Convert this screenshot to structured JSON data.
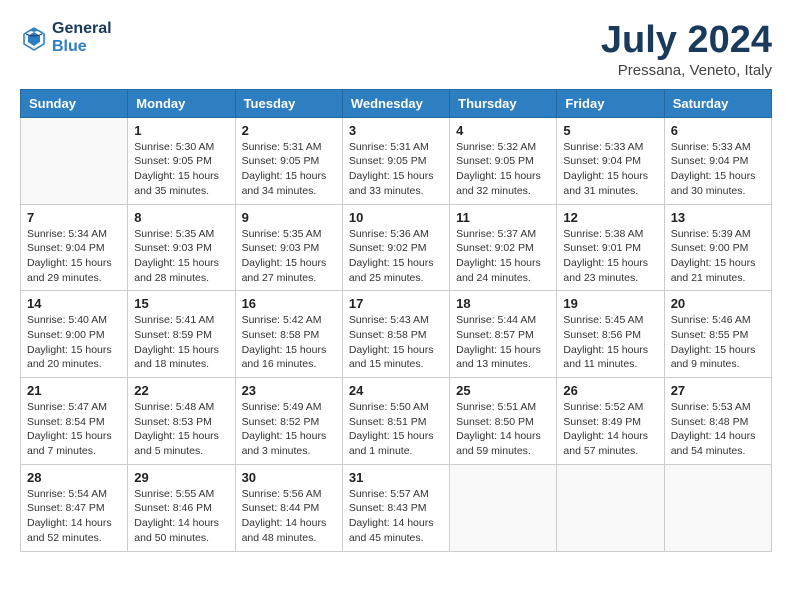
{
  "logo": {
    "line1": "General",
    "line2": "Blue"
  },
  "title": "July 2024",
  "subtitle": "Pressana, Veneto, Italy",
  "weekdays": [
    "Sunday",
    "Monday",
    "Tuesday",
    "Wednesday",
    "Thursday",
    "Friday",
    "Saturday"
  ],
  "weeks": [
    [
      {
        "day": null
      },
      {
        "day": 1,
        "sunrise": "5:30 AM",
        "sunset": "9:05 PM",
        "daylight": "15 hours and 35 minutes."
      },
      {
        "day": 2,
        "sunrise": "5:31 AM",
        "sunset": "9:05 PM",
        "daylight": "15 hours and 34 minutes."
      },
      {
        "day": 3,
        "sunrise": "5:31 AM",
        "sunset": "9:05 PM",
        "daylight": "15 hours and 33 minutes."
      },
      {
        "day": 4,
        "sunrise": "5:32 AM",
        "sunset": "9:05 PM",
        "daylight": "15 hours and 32 minutes."
      },
      {
        "day": 5,
        "sunrise": "5:33 AM",
        "sunset": "9:04 PM",
        "daylight": "15 hours and 31 minutes."
      },
      {
        "day": 6,
        "sunrise": "5:33 AM",
        "sunset": "9:04 PM",
        "daylight": "15 hours and 30 minutes."
      }
    ],
    [
      {
        "day": 7,
        "sunrise": "5:34 AM",
        "sunset": "9:04 PM",
        "daylight": "15 hours and 29 minutes."
      },
      {
        "day": 8,
        "sunrise": "5:35 AM",
        "sunset": "9:03 PM",
        "daylight": "15 hours and 28 minutes."
      },
      {
        "day": 9,
        "sunrise": "5:35 AM",
        "sunset": "9:03 PM",
        "daylight": "15 hours and 27 minutes."
      },
      {
        "day": 10,
        "sunrise": "5:36 AM",
        "sunset": "9:02 PM",
        "daylight": "15 hours and 25 minutes."
      },
      {
        "day": 11,
        "sunrise": "5:37 AM",
        "sunset": "9:02 PM",
        "daylight": "15 hours and 24 minutes."
      },
      {
        "day": 12,
        "sunrise": "5:38 AM",
        "sunset": "9:01 PM",
        "daylight": "15 hours and 23 minutes."
      },
      {
        "day": 13,
        "sunrise": "5:39 AM",
        "sunset": "9:00 PM",
        "daylight": "15 hours and 21 minutes."
      }
    ],
    [
      {
        "day": 14,
        "sunrise": "5:40 AM",
        "sunset": "9:00 PM",
        "daylight": "15 hours and 20 minutes."
      },
      {
        "day": 15,
        "sunrise": "5:41 AM",
        "sunset": "8:59 PM",
        "daylight": "15 hours and 18 minutes."
      },
      {
        "day": 16,
        "sunrise": "5:42 AM",
        "sunset": "8:58 PM",
        "daylight": "15 hours and 16 minutes."
      },
      {
        "day": 17,
        "sunrise": "5:43 AM",
        "sunset": "8:58 PM",
        "daylight": "15 hours and 15 minutes."
      },
      {
        "day": 18,
        "sunrise": "5:44 AM",
        "sunset": "8:57 PM",
        "daylight": "15 hours and 13 minutes."
      },
      {
        "day": 19,
        "sunrise": "5:45 AM",
        "sunset": "8:56 PM",
        "daylight": "15 hours and 11 minutes."
      },
      {
        "day": 20,
        "sunrise": "5:46 AM",
        "sunset": "8:55 PM",
        "daylight": "15 hours and 9 minutes."
      }
    ],
    [
      {
        "day": 21,
        "sunrise": "5:47 AM",
        "sunset": "8:54 PM",
        "daylight": "15 hours and 7 minutes."
      },
      {
        "day": 22,
        "sunrise": "5:48 AM",
        "sunset": "8:53 PM",
        "daylight": "15 hours and 5 minutes."
      },
      {
        "day": 23,
        "sunrise": "5:49 AM",
        "sunset": "8:52 PM",
        "daylight": "15 hours and 3 minutes."
      },
      {
        "day": 24,
        "sunrise": "5:50 AM",
        "sunset": "8:51 PM",
        "daylight": "15 hours and 1 minute."
      },
      {
        "day": 25,
        "sunrise": "5:51 AM",
        "sunset": "8:50 PM",
        "daylight": "14 hours and 59 minutes."
      },
      {
        "day": 26,
        "sunrise": "5:52 AM",
        "sunset": "8:49 PM",
        "daylight": "14 hours and 57 minutes."
      },
      {
        "day": 27,
        "sunrise": "5:53 AM",
        "sunset": "8:48 PM",
        "daylight": "14 hours and 54 minutes."
      }
    ],
    [
      {
        "day": 28,
        "sunrise": "5:54 AM",
        "sunset": "8:47 PM",
        "daylight": "14 hours and 52 minutes."
      },
      {
        "day": 29,
        "sunrise": "5:55 AM",
        "sunset": "8:46 PM",
        "daylight": "14 hours and 50 minutes."
      },
      {
        "day": 30,
        "sunrise": "5:56 AM",
        "sunset": "8:44 PM",
        "daylight": "14 hours and 48 minutes."
      },
      {
        "day": 31,
        "sunrise": "5:57 AM",
        "sunset": "8:43 PM",
        "daylight": "14 hours and 45 minutes."
      },
      {
        "day": null
      },
      {
        "day": null
      },
      {
        "day": null
      }
    ]
  ]
}
